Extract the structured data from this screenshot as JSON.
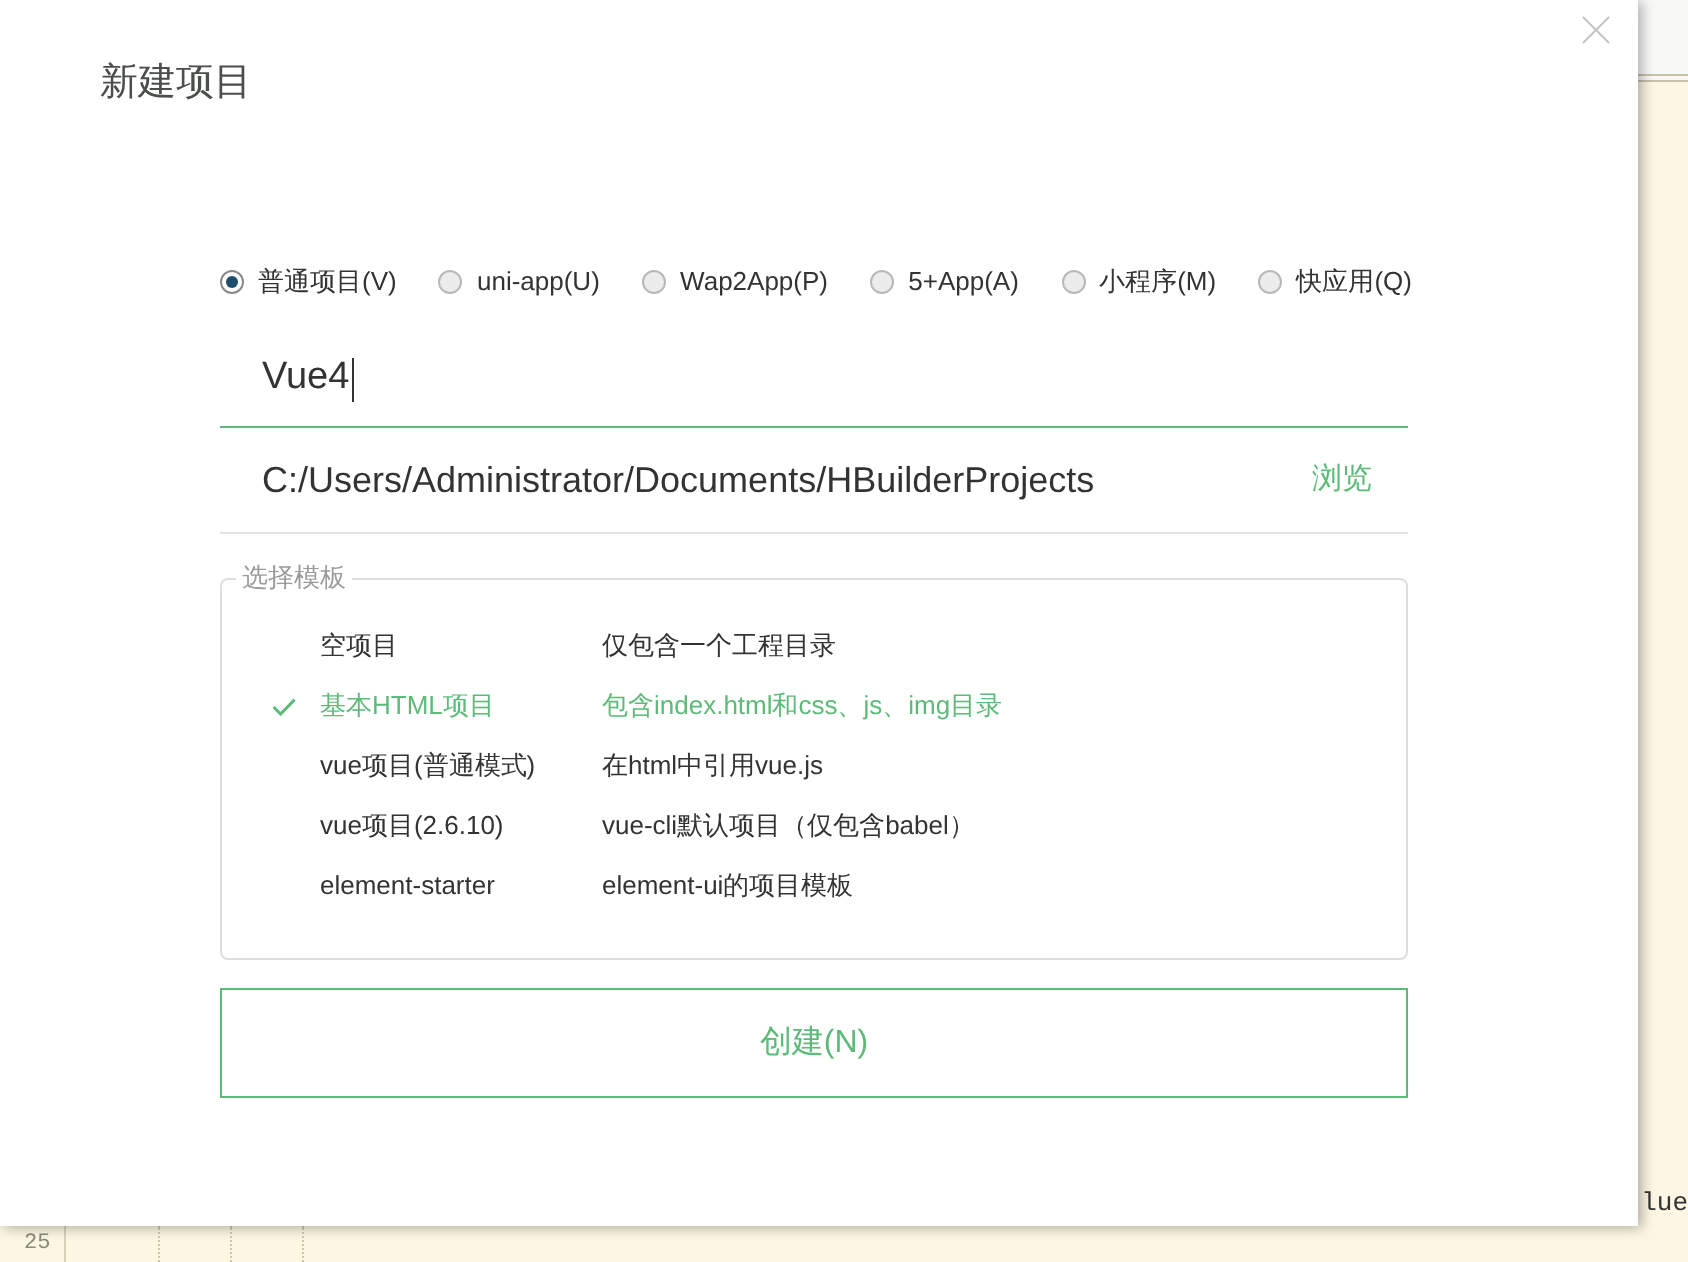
{
  "dialog": {
    "title": "新建项目"
  },
  "project_types": [
    {
      "label": "普通项目(V)",
      "selected": true
    },
    {
      "label": "uni-app(U)",
      "selected": false
    },
    {
      "label": "Wap2App(P)",
      "selected": false
    },
    {
      "label": "5+App(A)",
      "selected": false
    },
    {
      "label": "小程序(M)",
      "selected": false
    },
    {
      "label": "快应用(Q)",
      "selected": false
    }
  ],
  "name_field": {
    "value": "Vue4"
  },
  "location_field": {
    "value": "C:/Users/Administrator/Documents/HBuilderProjects",
    "browse_label": "浏览"
  },
  "templates": {
    "legend": "选择模板",
    "items": [
      {
        "name": "空项目",
        "description": "仅包含一个工程目录",
        "selected": false
      },
      {
        "name": "基本HTML项目",
        "description": "包含index.html和css、js、img目录",
        "selected": true
      },
      {
        "name": "vue项目(普通模式)",
        "description": "在html中引用vue.js",
        "selected": false
      },
      {
        "name": "vue项目(2.6.10)",
        "description": "vue-cli默认项目（仅包含babel）",
        "selected": false
      },
      {
        "name": "element-starter",
        "description": "element-ui的项目模板",
        "selected": false
      }
    ]
  },
  "create_button": {
    "label": "创建(N)"
  },
  "editor": {
    "code_fragment": "lue",
    "line_number": "25"
  }
}
